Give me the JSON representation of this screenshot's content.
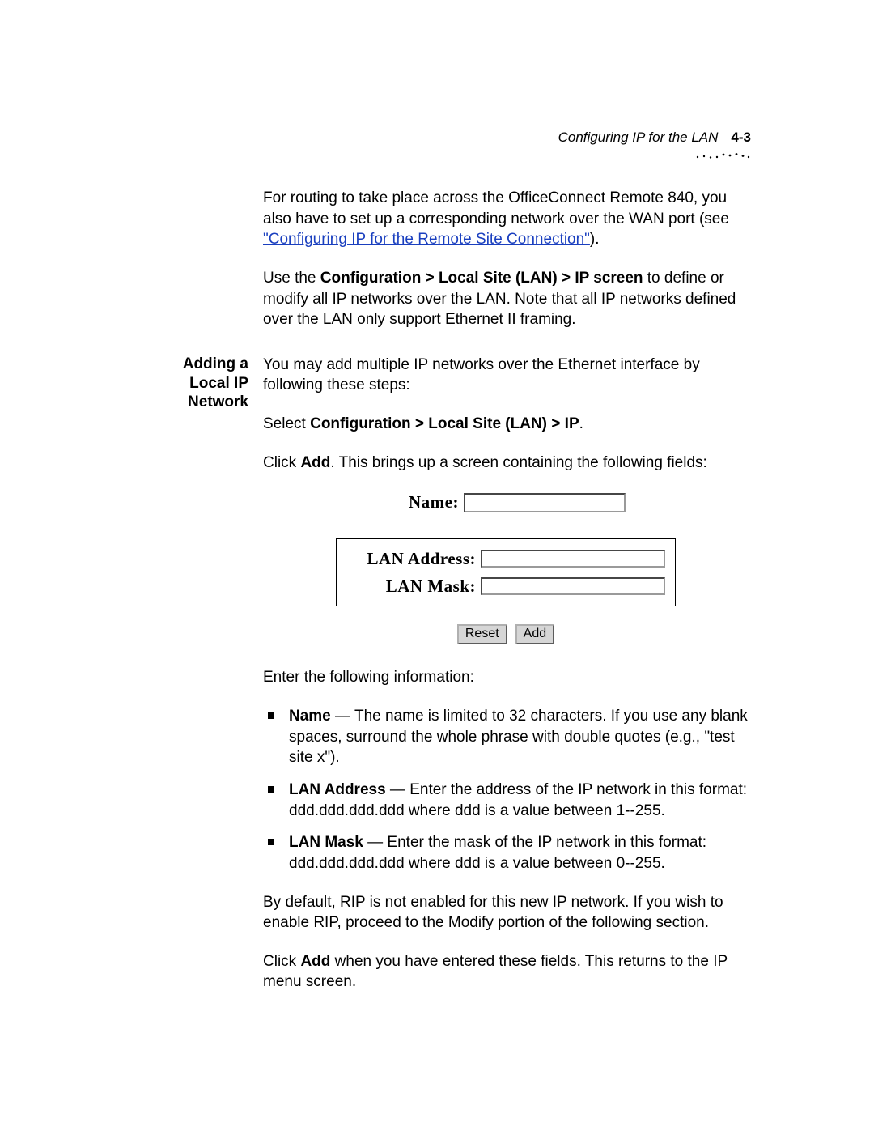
{
  "header": {
    "running_title": "Configuring IP for the LAN",
    "page_number": "4-3"
  },
  "intro": {
    "p1_pre": "For routing to take place across the OfficeConnect Remote 840, you also have to set up a corresponding network over the WAN port (see ",
    "p1_link": "\"Configuring IP for the Remote Site Connection\"",
    "p1_post": ").",
    "p2_pre": "Use the ",
    "p2_bold": "Configuration > Local Site (LAN) > IP screen",
    "p2_post": " to define or modify all IP networks over the LAN. Note that all IP networks defined over the LAN only support Ethernet II framing."
  },
  "section": {
    "margin_heading": "Adding a Local IP Network",
    "p1": "You may add multiple IP networks over the Ethernet interface by following these steps:",
    "p2_pre": "Select ",
    "p2_bold": "Configuration > Local Site (LAN) > IP",
    "p2_post": ".",
    "p3_pre": "Click ",
    "p3_bold": "Add",
    "p3_post": ". This brings up a screen containing the following fields:",
    "p_after_form": "Enter the following information:",
    "bullets": [
      {
        "title": "Name",
        "sep": " — ",
        "text": "The name is limited to 32 characters. If you use any blank spaces, surround the whole phrase with double quotes (e.g., \"test site x\")."
      },
      {
        "title": "LAN Address",
        "sep": " — ",
        "text": "Enter the address of the IP network in this format: ddd.ddd.ddd.ddd where ddd is a value between 1--255."
      },
      {
        "title": "LAN Mask",
        "sep": " — ",
        "text": "Enter the mask of the IP network in this format: ddd.ddd.ddd.ddd where ddd is a value between 0--255."
      }
    ],
    "p5": "By default, RIP is not enabled for this new IP network. If you wish to enable RIP, proceed to the Modify portion of the following section.",
    "p6_pre": "Click ",
    "p6_bold": "Add",
    "p6_post": " when you have entered these fields. This returns to the IP menu screen."
  },
  "form": {
    "name_label": "Name:",
    "name_value": "",
    "lan_address_label": "LAN Address:",
    "lan_address_value": "",
    "lan_mask_label": "LAN Mask:",
    "lan_mask_value": "",
    "reset_label": "Reset",
    "add_label": "Add"
  }
}
